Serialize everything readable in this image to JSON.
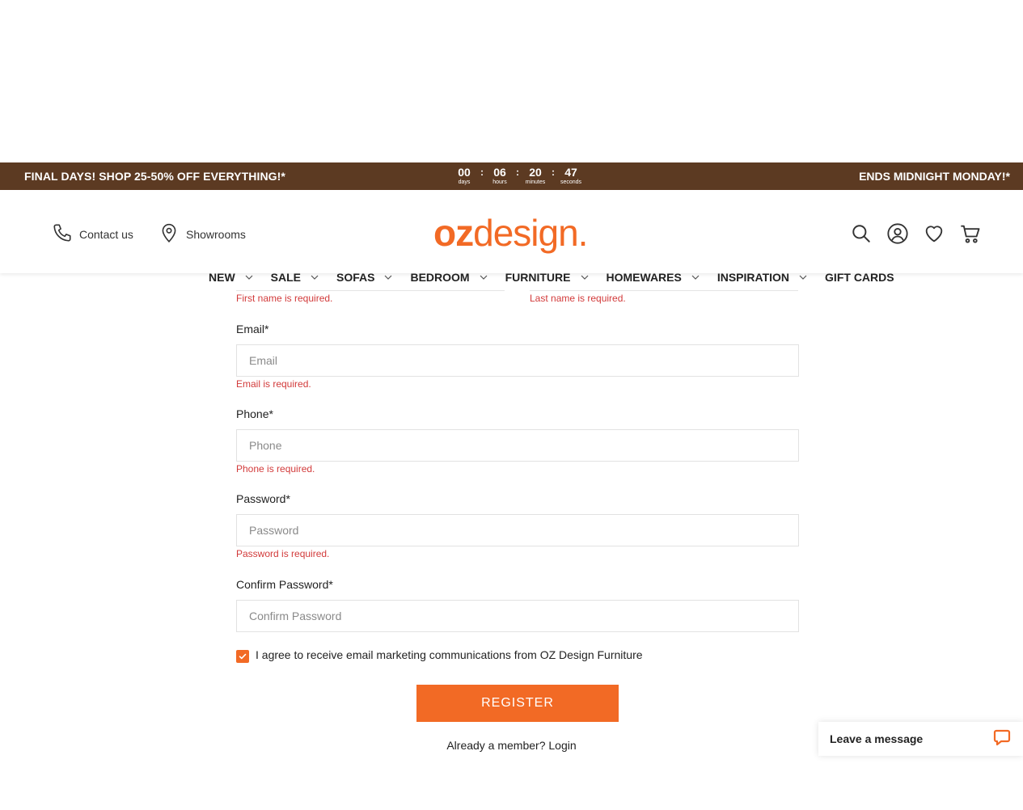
{
  "promo": {
    "left_text": "FINAL DAYS! SHOP 25-50% OFF EVERYTHING!*",
    "right_text": "ENDS MIDNIGHT MONDAY!*",
    "countdown": [
      {
        "value": "00",
        "label": "days"
      },
      {
        "value": "06",
        "label": "hours"
      },
      {
        "value": "20",
        "label": "minutes"
      },
      {
        "value": "47",
        "label": "seconds"
      }
    ],
    "separator": ":",
    "background": "#5c3a22"
  },
  "header": {
    "contact_label": "Contact us",
    "showrooms_label": "Showrooms",
    "logo_oz": "oz",
    "logo_design": "design.",
    "brand_color": "#f26a25",
    "icons": [
      "search-icon",
      "account-icon",
      "wishlist-icon",
      "cart-icon"
    ]
  },
  "nav": {
    "items": [
      {
        "label": "NEW",
        "dropdown": true
      },
      {
        "label": "SALE",
        "dropdown": true
      },
      {
        "label": "SOFAS",
        "dropdown": true
      },
      {
        "label": "BEDROOM",
        "dropdown": true
      },
      {
        "label": "FURNITURE",
        "dropdown": true
      },
      {
        "label": "HOMEWARES",
        "dropdown": true
      },
      {
        "label": "INSPIRATION",
        "dropdown": true
      },
      {
        "label": "GIFT CARDS",
        "dropdown": false
      }
    ]
  },
  "form": {
    "first_name_error": "First name is required.",
    "last_name_error": "Last name is required.",
    "email": {
      "label": "Email*",
      "placeholder": "Email",
      "value": "",
      "error": "Email is required."
    },
    "phone": {
      "label": "Phone*",
      "placeholder": "Phone",
      "value": "",
      "error": "Phone is required."
    },
    "password": {
      "label": "Password*",
      "placeholder": "Password",
      "value": "",
      "error": "Password is required."
    },
    "confirm_password": {
      "label": "Confirm Password*",
      "placeholder": "Confirm Password",
      "value": ""
    },
    "marketing_checkbox": {
      "label": "I agree to receive email marketing communications from OZ Design Furniture",
      "checked": true
    },
    "register_label": "Register",
    "member_prefix": "Already a member? ",
    "login_label": "Login",
    "error_color": "#d23a3a"
  },
  "chat": {
    "label": "Leave a message"
  }
}
